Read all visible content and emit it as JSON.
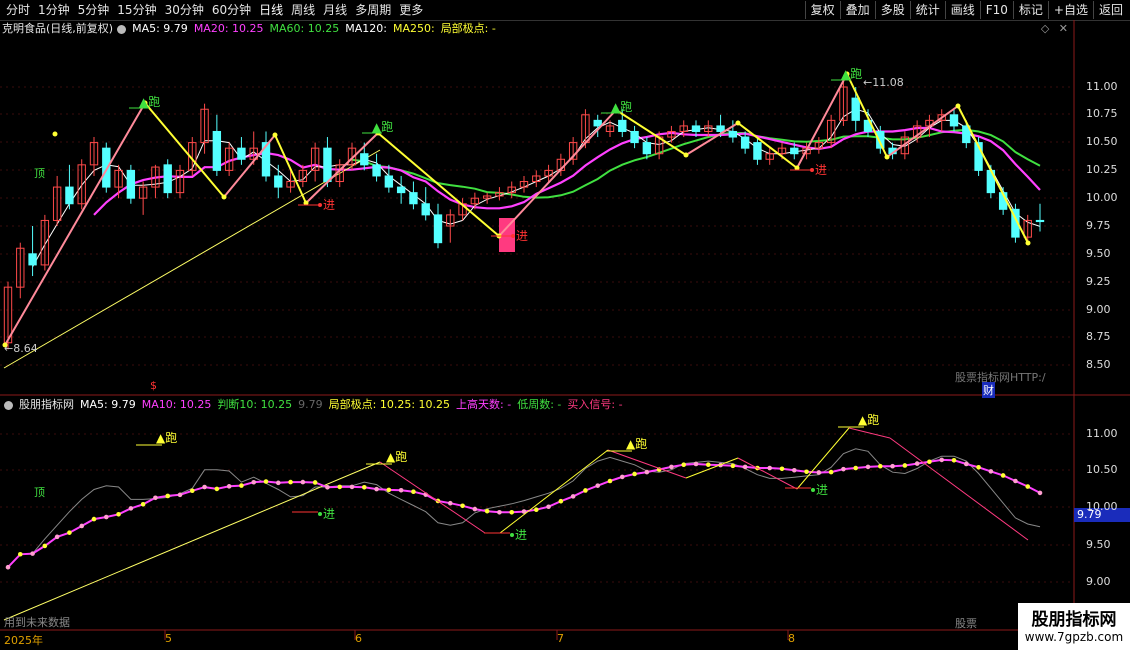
{
  "toolbar": {
    "left": [
      "分时",
      "1分钟",
      "5分钟",
      "15分钟",
      "30分钟",
      "60分钟",
      "日线",
      "周线",
      "月线",
      "多周期",
      "更多"
    ],
    "active": "日线",
    "right": [
      "复权",
      "叠加",
      "多股",
      "统计",
      "画线",
      "F10",
      "标记",
      "+自选",
      "返回"
    ]
  },
  "main_legend": {
    "title": "克明食品(日线,前复权)",
    "ma5": "MA5: 9.79",
    "ma20": "MA20: 10.25",
    "ma60": "MA60: 10.25",
    "ma120": "MA120:",
    "ma250": "MA250:",
    "extreme": "局部极点: -"
  },
  "sub_legend": {
    "title": "股朋指标网",
    "ma5": "MA5: 9.79",
    "ma10": "MA10: 10.25",
    "judge": "判断10: 10.25",
    "dim": "9.79",
    "extreme": "局部极点: 10.25",
    "extreme2": ": 10.25",
    "up_days": "上高天数: -",
    "low_weeks": "低周数: -",
    "buy": "买入信号: -"
  },
  "main_axis": [
    "11.00",
    "10.75",
    "10.50",
    "10.25",
    "10.00",
    "9.75",
    "9.50",
    "9.25",
    "9.00",
    "8.75",
    "8.50"
  ],
  "sub_axis": [
    "11.00",
    "10.50",
    "10.00",
    "9.50",
    "9.00"
  ],
  "value_tag": "9.79",
  "dates": [
    "2025年",
    "5",
    "6",
    "7",
    "8"
  ],
  "labels": {
    "run": "跑",
    "enter": "进",
    "top": "顶",
    "low_price": "8.64",
    "high_price": "11.08",
    "watermark": "股票指标网HTTP:/",
    "cai": "财",
    "future": "用到未来数据",
    "sub_watermark": "股票",
    "dollar": "$"
  },
  "logo": {
    "line1": "股朋指标网",
    "line2": "www.7gpzb.com"
  },
  "colors": {
    "up": "#ff4a4a",
    "down": "#54ffff",
    "ma5": "#ffffff",
    "ma20": "#ff40ff",
    "ma60": "#40e040",
    "zig": "#ffff33",
    "run": "#ffff33",
    "enter": "#ff3333",
    "pink": "#ff3a80"
  },
  "chart_data": {
    "type": "candlestick",
    "title": "克明食品(日线,前复权)",
    "ylim": [
      8.4,
      11.4
    ],
    "candles": [
      {
        "o": 8.7,
        "h": 9.25,
        "l": 8.64,
        "c": 9.2
      },
      {
        "o": 9.2,
        "h": 9.6,
        "l": 9.1,
        "c": 9.55
      },
      {
        "o": 9.5,
        "h": 9.75,
        "l": 9.3,
        "c": 9.4
      },
      {
        "o": 9.4,
        "h": 9.85,
        "l": 9.35,
        "c": 9.8
      },
      {
        "o": 9.8,
        "h": 10.2,
        "l": 9.75,
        "c": 10.1
      },
      {
        "o": 10.1,
        "h": 10.3,
        "l": 9.9,
        "c": 9.95
      },
      {
        "o": 9.95,
        "h": 10.35,
        "l": 9.9,
        "c": 10.3
      },
      {
        "o": 10.3,
        "h": 10.55,
        "l": 10.2,
        "c": 10.5
      },
      {
        "o": 10.45,
        "h": 10.5,
        "l": 10.05,
        "c": 10.1
      },
      {
        "o": 10.1,
        "h": 10.3,
        "l": 10.0,
        "c": 10.25
      },
      {
        "o": 10.25,
        "h": 10.3,
        "l": 9.95,
        "c": 10.0
      },
      {
        "o": 10.0,
        "h": 10.15,
        "l": 9.85,
        "c": 10.1
      },
      {
        "o": 10.1,
        "h": 10.3,
        "l": 10.0,
        "c": 10.28
      },
      {
        "o": 10.3,
        "h": 10.35,
        "l": 10.0,
        "c": 10.05
      },
      {
        "o": 10.05,
        "h": 10.3,
        "l": 10.0,
        "c": 10.25
      },
      {
        "o": 10.25,
        "h": 10.55,
        "l": 10.2,
        "c": 10.5
      },
      {
        "o": 10.5,
        "h": 10.85,
        "l": 10.4,
        "c": 10.8
      },
      {
        "o": 10.6,
        "h": 10.75,
        "l": 10.2,
        "c": 10.25
      },
      {
        "o": 10.25,
        "h": 10.5,
        "l": 10.2,
        "c": 10.45
      },
      {
        "o": 10.45,
        "h": 10.55,
        "l": 10.3,
        "c": 10.35
      },
      {
        "o": 10.35,
        "h": 10.6,
        "l": 10.3,
        "c": 10.45
      },
      {
        "o": 10.5,
        "h": 10.6,
        "l": 10.15,
        "c": 10.2
      },
      {
        "o": 10.2,
        "h": 10.3,
        "l": 10.0,
        "c": 10.1
      },
      {
        "o": 10.1,
        "h": 10.25,
        "l": 10.05,
        "c": 10.15
      },
      {
        "o": 10.15,
        "h": 10.3,
        "l": 10.1,
        "c": 10.25
      },
      {
        "o": 10.25,
        "h": 10.5,
        "l": 10.15,
        "c": 10.45
      },
      {
        "o": 10.45,
        "h": 10.55,
        "l": 10.1,
        "c": 10.15
      },
      {
        "o": 10.15,
        "h": 10.35,
        "l": 10.1,
        "c": 10.3
      },
      {
        "o": 10.3,
        "h": 10.5,
        "l": 10.25,
        "c": 10.45
      },
      {
        "o": 10.4,
        "h": 10.5,
        "l": 10.25,
        "c": 10.3
      },
      {
        "o": 10.3,
        "h": 10.4,
        "l": 10.15,
        "c": 10.2
      },
      {
        "o": 10.2,
        "h": 10.3,
        "l": 10.05,
        "c": 10.1
      },
      {
        "o": 10.1,
        "h": 10.2,
        "l": 9.95,
        "c": 10.05
      },
      {
        "o": 10.05,
        "h": 10.15,
        "l": 9.9,
        "c": 9.95
      },
      {
        "o": 9.95,
        "h": 10.1,
        "l": 9.8,
        "c": 9.85
      },
      {
        "o": 9.85,
        "h": 9.95,
        "l": 9.55,
        "c": 9.6
      },
      {
        "o": 9.75,
        "h": 9.9,
        "l": 9.6,
        "c": 9.85
      },
      {
        "o": 9.85,
        "h": 10.0,
        "l": 9.8,
        "c": 9.95
      },
      {
        "o": 9.95,
        "h": 10.05,
        "l": 9.9,
        "c": 10.0
      },
      {
        "o": 10.0,
        "h": 10.05,
        "l": 9.95,
        "c": 10.02
      },
      {
        "o": 10.02,
        "h": 10.1,
        "l": 9.98,
        "c": 10.05
      },
      {
        "o": 10.05,
        "h": 10.15,
        "l": 10.0,
        "c": 10.1
      },
      {
        "o": 10.1,
        "h": 10.2,
        "l": 10.05,
        "c": 10.15
      },
      {
        "o": 10.15,
        "h": 10.25,
        "l": 10.1,
        "c": 10.2
      },
      {
        "o": 10.2,
        "h": 10.3,
        "l": 10.15,
        "c": 10.25
      },
      {
        "o": 10.25,
        "h": 10.4,
        "l": 10.2,
        "c": 10.35
      },
      {
        "o": 10.35,
        "h": 10.55,
        "l": 10.3,
        "c": 10.5
      },
      {
        "o": 10.5,
        "h": 10.8,
        "l": 10.45,
        "c": 10.75
      },
      {
        "o": 10.7,
        "h": 10.75,
        "l": 10.55,
        "c": 10.65
      },
      {
        "o": 10.6,
        "h": 10.7,
        "l": 10.55,
        "c": 10.65
      },
      {
        "o": 10.7,
        "h": 10.8,
        "l": 10.55,
        "c": 10.6
      },
      {
        "o": 10.6,
        "h": 10.65,
        "l": 10.45,
        "c": 10.5
      },
      {
        "o": 10.5,
        "h": 10.55,
        "l": 10.35,
        "c": 10.4
      },
      {
        "o": 10.4,
        "h": 10.6,
        "l": 10.35,
        "c": 10.55
      },
      {
        "o": 10.55,
        "h": 10.65,
        "l": 10.5,
        "c": 10.6
      },
      {
        "o": 10.6,
        "h": 10.7,
        "l": 10.55,
        "c": 10.65
      },
      {
        "o": 10.65,
        "h": 10.7,
        "l": 10.55,
        "c": 10.6
      },
      {
        "o": 10.6,
        "h": 10.7,
        "l": 10.55,
        "c": 10.65
      },
      {
        "o": 10.65,
        "h": 10.75,
        "l": 10.55,
        "c": 10.6
      },
      {
        "o": 10.6,
        "h": 10.7,
        "l": 10.5,
        "c": 10.55
      },
      {
        "o": 10.55,
        "h": 10.6,
        "l": 10.4,
        "c": 10.45
      },
      {
        "o": 10.5,
        "h": 10.55,
        "l": 10.3,
        "c": 10.35
      },
      {
        "o": 10.35,
        "h": 10.45,
        "l": 10.3,
        "c": 10.4
      },
      {
        "o": 10.4,
        "h": 10.5,
        "l": 10.35,
        "c": 10.45
      },
      {
        "o": 10.45,
        "h": 10.5,
        "l": 10.35,
        "c": 10.4
      },
      {
        "o": 10.4,
        "h": 10.5,
        "l": 10.35,
        "c": 10.45
      },
      {
        "o": 10.45,
        "h": 10.55,
        "l": 10.4,
        "c": 10.5
      },
      {
        "o": 10.5,
        "h": 10.75,
        "l": 10.45,
        "c": 10.7
      },
      {
        "o": 10.7,
        "h": 11.08,
        "l": 10.65,
        "c": 11.0
      },
      {
        "o": 10.9,
        "h": 11.0,
        "l": 10.6,
        "c": 10.7
      },
      {
        "o": 10.7,
        "h": 10.8,
        "l": 10.55,
        "c": 10.6
      },
      {
        "o": 10.6,
        "h": 10.65,
        "l": 10.4,
        "c": 10.45
      },
      {
        "o": 10.45,
        "h": 10.5,
        "l": 10.35,
        "c": 10.4
      },
      {
        "o": 10.4,
        "h": 10.6,
        "l": 10.35,
        "c": 10.55
      },
      {
        "o": 10.55,
        "h": 10.7,
        "l": 10.5,
        "c": 10.65
      },
      {
        "o": 10.65,
        "h": 10.75,
        "l": 10.55,
        "c": 10.7
      },
      {
        "o": 10.7,
        "h": 10.8,
        "l": 10.6,
        "c": 10.75
      },
      {
        "o": 10.75,
        "h": 10.8,
        "l": 10.6,
        "c": 10.65
      },
      {
        "o": 10.65,
        "h": 10.7,
        "l": 10.45,
        "c": 10.5
      },
      {
        "o": 10.5,
        "h": 10.55,
        "l": 10.2,
        "c": 10.25
      },
      {
        "o": 10.25,
        "h": 10.3,
        "l": 10.0,
        "c": 10.05
      },
      {
        "o": 10.05,
        "h": 10.1,
        "l": 9.85,
        "c": 9.9
      },
      {
        "o": 9.9,
        "h": 9.95,
        "l": 9.6,
        "c": 9.65
      },
      {
        "o": 9.65,
        "h": 9.85,
        "l": 9.6,
        "c": 9.8
      },
      {
        "o": 9.8,
        "h": 9.95,
        "l": 9.7,
        "c": 9.79
      }
    ]
  }
}
